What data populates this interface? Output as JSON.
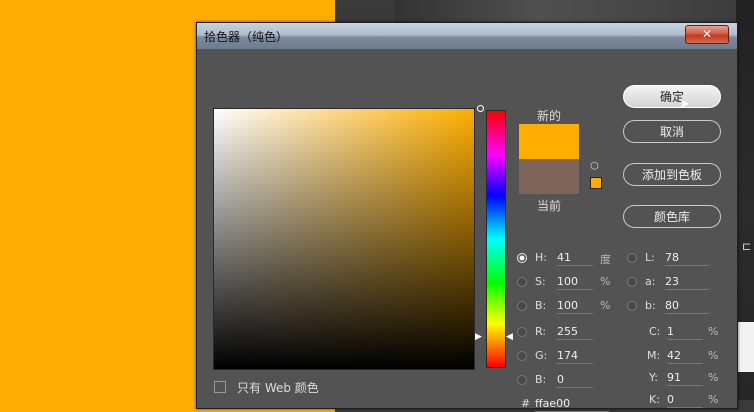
{
  "dialog": {
    "title": "拾色器（纯色）",
    "close_glyph": "✕"
  },
  "preview": {
    "new_label": "新的",
    "current_label": "当前",
    "new_color": "#ffae00",
    "current_color": "#7f6459"
  },
  "buttons": {
    "ok": "确定",
    "cancel": "取消",
    "add_to_swatches": "添加到色板",
    "color_libraries": "颜色库"
  },
  "hsb": {
    "h_label": "H:",
    "h_value": "41",
    "h_unit": "度",
    "s_label": "S:",
    "s_value": "100",
    "s_unit": "%",
    "b_label": "B:",
    "b_value": "100",
    "b_unit": "%"
  },
  "rgb": {
    "r_label": "R:",
    "r_value": "255",
    "g_label": "G:",
    "g_value": "174",
    "b_label": "B:",
    "b_value": "0"
  },
  "lab": {
    "l_label": "L:",
    "l_value": "78",
    "a_label": "a:",
    "a_value": "23",
    "b_label": "b:",
    "b_value": "80"
  },
  "cmyk": {
    "c_label": "C:",
    "c_value": "1",
    "c_unit": "%",
    "m_label": "M:",
    "m_value": "42",
    "m_unit": "%",
    "y_label": "Y:",
    "y_value": "91",
    "y_unit": "%",
    "k_label": "K:",
    "k_value": "0",
    "k_unit": "%"
  },
  "hex": {
    "label": "#",
    "value": "ffae00"
  },
  "web_only": {
    "label": "只有 Web 颜色",
    "checked": false
  },
  "colors": {
    "accent": "#ffae00",
    "dialog_bg": "#535353"
  },
  "icons": [
    "close-icon",
    "cube-icon",
    "cursor-icon"
  ]
}
